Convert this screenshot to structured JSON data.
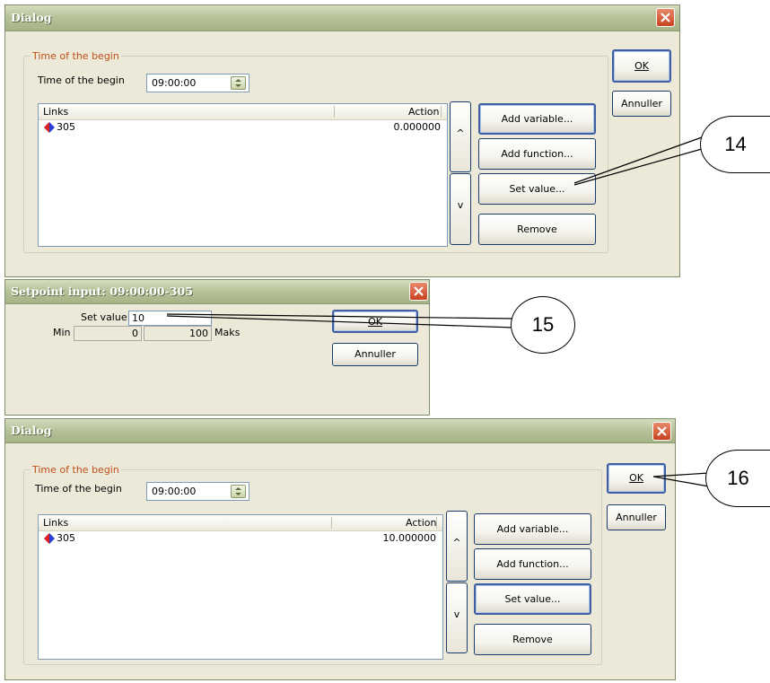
{
  "dialog1": {
    "title": "Dialog",
    "group_label": "Time of the begin",
    "time_label": "Time of the begin",
    "time_value": "09:00:00",
    "columns": [
      "Links",
      "Action"
    ],
    "rows": [
      {
        "link": "305",
        "action": "0.000000"
      }
    ],
    "buttons": {
      "add_variable": "Add variable...",
      "add_function": "Add function...",
      "set_value": "Set value...",
      "remove": "Remove",
      "up": "^",
      "down": "v"
    },
    "ok_label": "OK",
    "cancel_label": "Annuller"
  },
  "dialog2": {
    "title": "Setpoint input: 09:00:00-305",
    "set_value_label": "Set value:",
    "set_value": "10",
    "min_label": "Min",
    "min_value": "0",
    "max_value": "100",
    "max_label": "Maks",
    "ok_label": "OK",
    "cancel_label": "Annuller"
  },
  "dialog3": {
    "title": "Dialog",
    "group_label": "Time of the begin",
    "time_label": "Time of the begin",
    "time_value": "09:00:00",
    "columns": [
      "Links",
      "Action"
    ],
    "rows": [
      {
        "link": "305",
        "action": "10.000000"
      }
    ],
    "buttons": {
      "add_variable": "Add variable...",
      "add_function": "Add function...",
      "set_value": "Set value...",
      "remove": "Remove",
      "up": "^",
      "down": "v"
    },
    "ok_label": "OK",
    "cancel_label": "Annuller"
  },
  "callouts": [
    "14",
    "15",
    "16"
  ]
}
